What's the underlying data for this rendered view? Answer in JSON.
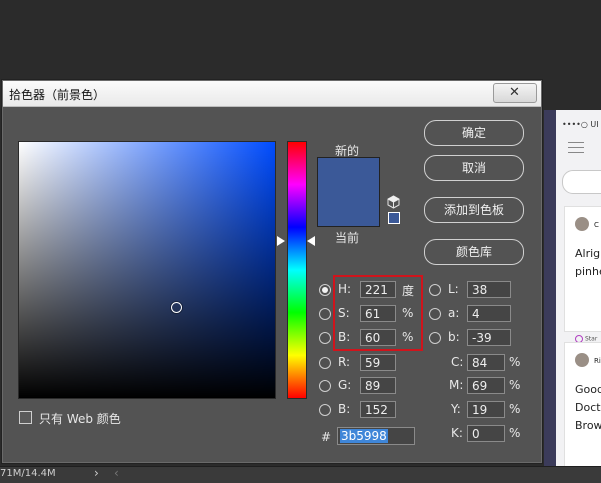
{
  "statusbar": {
    "doc_size": "71M/14.4M",
    "arrow": "›",
    "scroll_arrow": "‹"
  },
  "phone_preview": {
    "status_text": "••••○ UI",
    "card1": {
      "name": "C",
      "lines": [
        "Alrig",
        "pinhe"
      ],
      "tag": "Star"
    },
    "card2": {
      "name": "Ri",
      "lines": [
        "Good",
        "Doct",
        "Brow"
      ]
    }
  },
  "dialog": {
    "title": "拾色器（前景色）",
    "close_symbol": "✕",
    "web_colors_label": "只有 Web 颜色",
    "web_colors_checked": false,
    "new_label": "新的",
    "current_label": "当前",
    "new_color": "#3b5998",
    "current_color": "#3b5998",
    "buttons": {
      "ok": "确定",
      "cancel": "取消",
      "add_swatch": "添加到色板",
      "libraries": "颜色库"
    },
    "hsb": {
      "h": {
        "label": "H:",
        "value": "221",
        "unit": "度"
      },
      "s": {
        "label": "S:",
        "value": "61",
        "unit": "%"
      },
      "b": {
        "label": "B:",
        "value": "60",
        "unit": "%"
      }
    },
    "rgb": {
      "r": {
        "label": "R:",
        "value": "59"
      },
      "g": {
        "label": "G:",
        "value": "89"
      },
      "b": {
        "label": "B:",
        "value": "152"
      }
    },
    "lab": {
      "l": {
        "label": "L:",
        "value": "38"
      },
      "a": {
        "label": "a:",
        "value": "4"
      },
      "b": {
        "label": "b:",
        "value": "-39"
      }
    },
    "cmyk": {
      "c": {
        "label": "C:",
        "value": "84",
        "unit": "%"
      },
      "m": {
        "label": "M:",
        "value": "69",
        "unit": "%"
      },
      "y": {
        "label": "Y:",
        "value": "19",
        "unit": "%"
      },
      "k": {
        "label": "K:",
        "value": "0",
        "unit": "%"
      }
    },
    "hex": {
      "hash": "#",
      "value": "3b5998"
    },
    "selected_mode": "H",
    "highlight_color": "#d0141c"
  }
}
